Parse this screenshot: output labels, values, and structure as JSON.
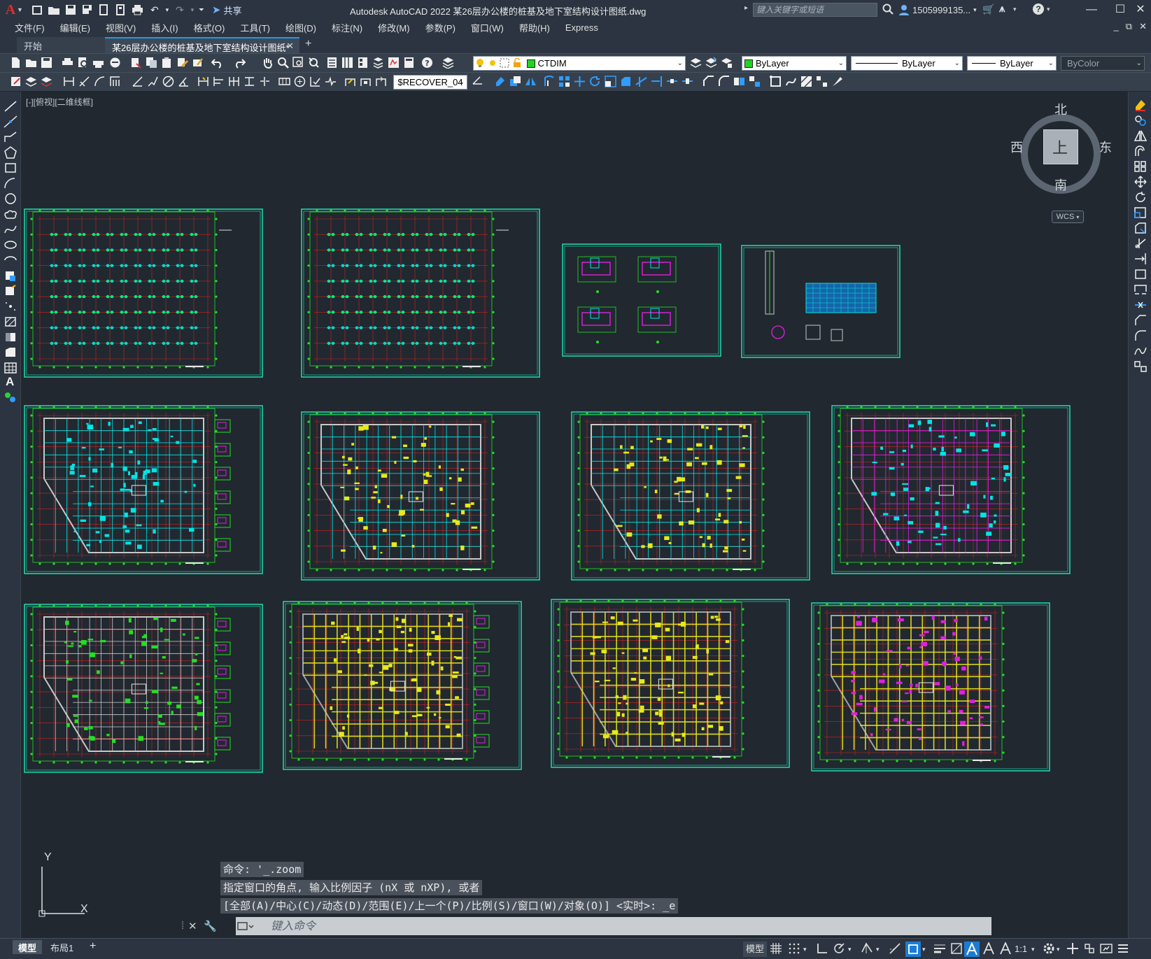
{
  "window": {
    "title": "Autodesk AutoCAD 2022    某26层办公楼的桩基及地下室结构设计图纸.dwg",
    "share_label": "共享",
    "search_placeholder": "键入关键字或短语",
    "user": "1505999135...",
    "logo": "A"
  },
  "menu": [
    "文件(F)",
    "编辑(E)",
    "视图(V)",
    "插入(I)",
    "格式(O)",
    "工具(T)",
    "绘图(D)",
    "标注(N)",
    "修改(M)",
    "参数(P)",
    "窗口(W)",
    "帮助(H)",
    "Express"
  ],
  "tabs": {
    "start": "开始",
    "active": "某26层办公楼的桩基及地下室结构设计图纸*"
  },
  "toolbar": {
    "layer": "CTDIM",
    "color": "ByLayer",
    "linetype": "ByLayer",
    "lineweight": "ByLayer",
    "plotstyle": "ByColor",
    "dimstyle": "$RECOVER_04"
  },
  "canvas": {
    "view_label": "[-][俯视][二维线框]",
    "viewcube": {
      "north": "北",
      "south": "南",
      "east": "东",
      "west": "西",
      "face": "上",
      "wcs": "WCS"
    },
    "ucs": {
      "x": "X",
      "y": "Y"
    }
  },
  "command": {
    "history": [
      "命令: '_.zoom",
      "指定窗口的角点, 输入比例因子 (nX 或 nXP), 或者",
      "[全部(A)/中心(C)/动态(D)/范围(E)/上一个(P)/比例(S)/窗口(W)/对象(O)] <实时>: _e"
    ],
    "placeholder": "键入命令"
  },
  "status": {
    "tabs": {
      "model": "模型",
      "layout1": "布局1",
      "add": "+"
    },
    "model_label": "模型",
    "scale": "1:1"
  },
  "colors": {
    "canvas": "#212830",
    "frame": "#1fd3a8",
    "grid": "#d42020",
    "dim": "#22e022",
    "column": "#00e5e5",
    "beam": "#e8e81a",
    "wall": "#c8c8c8",
    "rebar": "#e020e0"
  }
}
